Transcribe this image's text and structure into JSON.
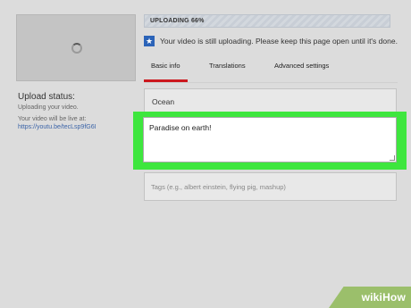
{
  "upload": {
    "progress_label": "UPLOADING 66%",
    "progress_fraction": 0.66,
    "notice": "Your video is still uploading. Please keep this page open until it's done.",
    "status_title": "Upload status:",
    "status_text": "Uploading your video.",
    "live_text": "Your video will be live at:",
    "live_link": "https://youtu.be/tecLsp9fG6I"
  },
  "tabs": [
    {
      "label": "Basic info",
      "active": true
    },
    {
      "label": "Translations",
      "active": false
    },
    {
      "label": "Advanced settings",
      "active": false
    }
  ],
  "form": {
    "title_value": "Ocean",
    "description_value": "Paradise on earth!",
    "tags_placeholder": "Tags (e.g., albert einstein, flying pig, mashup)"
  },
  "colors": {
    "highlight": "#3ee63e",
    "active_tab": "#cc181e",
    "link": "#3b64a8"
  },
  "icons": {
    "notice": "star-icon",
    "thumbnail": "loading-spinner-icon"
  },
  "watermark": {
    "text": "wikiHow"
  }
}
